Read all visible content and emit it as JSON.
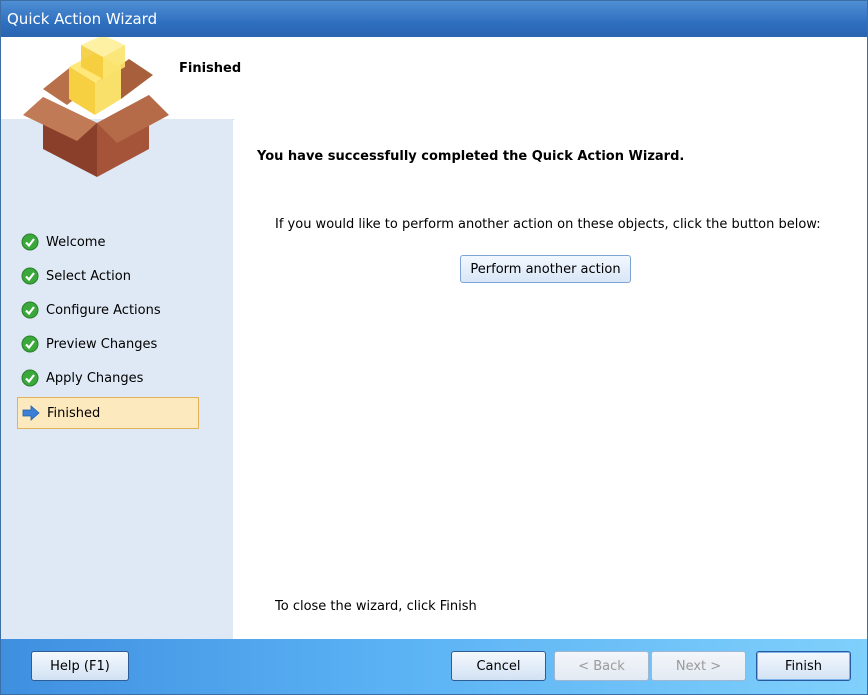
{
  "window": {
    "title": "Quick Action Wizard"
  },
  "header": {
    "title": "Finished",
    "logo_icon": "package-box-icon"
  },
  "sidebar": {
    "steps": [
      {
        "label": "Welcome",
        "icon": "check-circle-icon",
        "state": "done"
      },
      {
        "label": "Select Action",
        "icon": "check-circle-icon",
        "state": "done"
      },
      {
        "label": "Configure Actions",
        "icon": "check-circle-icon",
        "state": "done"
      },
      {
        "label": "Preview Changes",
        "icon": "check-circle-icon",
        "state": "done"
      },
      {
        "label": "Apply Changes",
        "icon": "check-circle-icon",
        "state": "done"
      },
      {
        "label": "Finished",
        "icon": "arrow-right-icon",
        "state": "current"
      }
    ]
  },
  "main": {
    "success_message": "You have successfully completed the Quick Action Wizard.",
    "instruction": "If you would like to perform another action on these objects, click the button below:",
    "perform_button": "Perform another action",
    "close_note": "To close the wizard, click Finish"
  },
  "footer": {
    "help_button": "Help (F1)",
    "cancel_button": "Cancel",
    "back_button": "< Back",
    "next_button": "Next >",
    "finish_button": "Finish"
  },
  "colors": {
    "titlebar": "#2f6fc0",
    "sidebar": "#dfe9f5",
    "current_step_bg": "#fde9be",
    "check_green": "#3aa83a",
    "arrow_blue": "#3b7fd6"
  }
}
